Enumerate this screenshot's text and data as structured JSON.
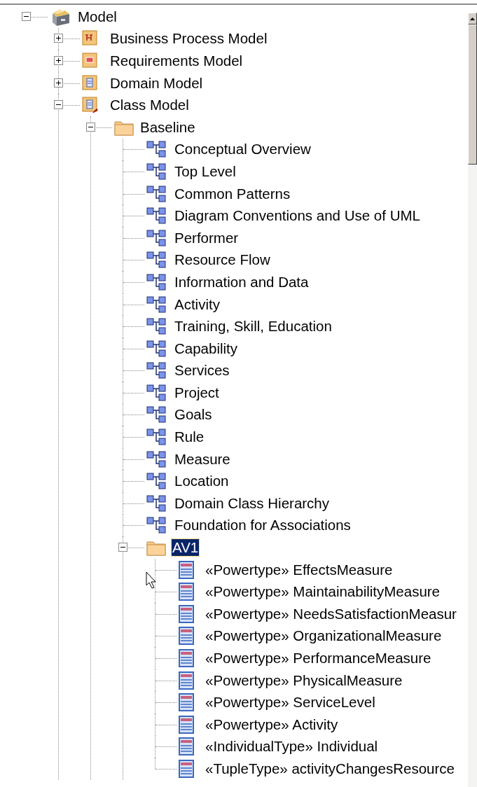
{
  "tree": [
    {
      "label": "Model",
      "kind": "model",
      "expanded": true,
      "selected": false,
      "children": [
        {
          "label": "Business Process Model",
          "kind": "process",
          "expanded": false,
          "selected": false
        },
        {
          "label": "Requirements Model",
          "kind": "requirements",
          "expanded": false,
          "selected": false
        },
        {
          "label": "Domain Model",
          "kind": "domain",
          "expanded": false,
          "selected": false
        },
        {
          "label": "Class Model",
          "kind": "classmodel",
          "expanded": true,
          "selected": false,
          "children": [
            {
              "label": "Baseline",
              "kind": "folder",
              "expanded": true,
              "selected": false,
              "children": [
                {
                  "label": "Conceptual Overview",
                  "kind": "diagram",
                  "selected": false
                },
                {
                  "label": "Top Level",
                  "kind": "diagram",
                  "selected": false
                },
                {
                  "label": "Common Patterns",
                  "kind": "diagram",
                  "selected": false
                },
                {
                  "label": "Diagram Conventions and Use of UML",
                  "kind": "diagram",
                  "selected": false
                },
                {
                  "label": "Performer",
                  "kind": "diagram",
                  "selected": false
                },
                {
                  "label": "Resource Flow",
                  "kind": "diagram",
                  "selected": false
                },
                {
                  "label": "Information and Data",
                  "kind": "diagram",
                  "selected": false
                },
                {
                  "label": "Activity",
                  "kind": "diagram",
                  "selected": false
                },
                {
                  "label": "Training, Skill, Education",
                  "kind": "diagram",
                  "selected": false
                },
                {
                  "label": "Capability",
                  "kind": "diagram",
                  "selected": false
                },
                {
                  "label": "Services",
                  "kind": "diagram",
                  "selected": false
                },
                {
                  "label": "Project",
                  "kind": "diagram",
                  "selected": false
                },
                {
                  "label": "Goals",
                  "kind": "diagram",
                  "selected": false
                },
                {
                  "label": "Rule",
                  "kind": "diagram",
                  "selected": false
                },
                {
                  "label": "Measure",
                  "kind": "diagram",
                  "selected": false
                },
                {
                  "label": "Location",
                  "kind": "diagram",
                  "selected": false
                },
                {
                  "label": "Domain Class Hierarchy",
                  "kind": "diagram",
                  "selected": false
                },
                {
                  "label": "Foundation for Associations",
                  "kind": "diagram",
                  "selected": false
                },
                {
                  "label": "AV1",
                  "kind": "folder",
                  "expanded": true,
                  "selected": true,
                  "children": [
                    {
                      "label": "«Powertype» EffectsMeasure",
                      "kind": "element",
                      "selected": false
                    },
                    {
                      "label": "«Powertype» MaintainabilityMeasure",
                      "kind": "element",
                      "selected": false
                    },
                    {
                      "label": "«Powertype» NeedsSatisfactionMeasur",
                      "kind": "element",
                      "selected": false
                    },
                    {
                      "label": "«Powertype» OrganizationalMeasure",
                      "kind": "element",
                      "selected": false
                    },
                    {
                      "label": "«Powertype» PerformanceMeasure",
                      "kind": "element",
                      "selected": false
                    },
                    {
                      "label": "«Powertype» PhysicalMeasure",
                      "kind": "element",
                      "selected": false
                    },
                    {
                      "label": "«Powertype» ServiceLevel",
                      "kind": "element",
                      "selected": false
                    },
                    {
                      "label": "«Powertype» Activity",
                      "kind": "element",
                      "selected": false
                    },
                    {
                      "label": "«IndividualType» Individual",
                      "kind": "element",
                      "selected": false
                    },
                    {
                      "label": "«TupleType» activityChangesResource",
                      "kind": "element",
                      "selected": false
                    }
                  ]
                }
              ]
            }
          ]
        }
      ]
    }
  ]
}
